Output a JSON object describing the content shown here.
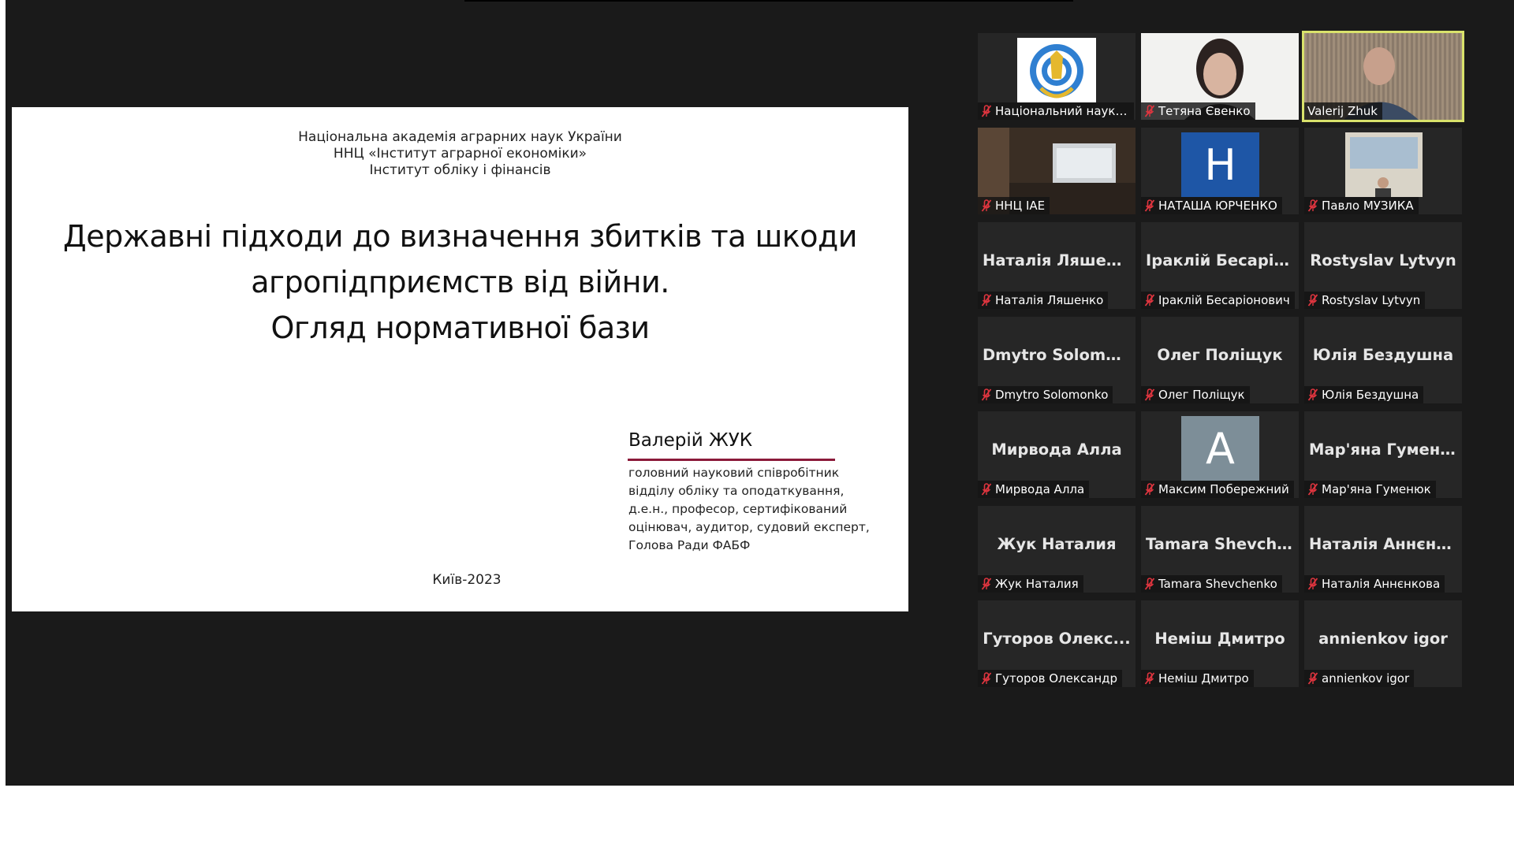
{
  "slide": {
    "institution_lines": [
      "Національна академія аграрних наук України",
      "ННЦ «Інститут аграрної економіки»",
      "Інститут обліку і фінансів"
    ],
    "title_lines": [
      "Державні підходи до визначення збитків та шкоди",
      "агропідприємств від війни.",
      "Огляд нормативної бази"
    ],
    "author": "Валерій ЖУК",
    "author_position_lines": [
      "головний науковий співробітник",
      "відділу обліку та оподаткування,",
      "д.е.н., професор, сертифікований",
      "оцінювач, аудитор, судовий експерт,",
      "Голова Ради ФАБФ"
    ],
    "city_year": "Київ-2023",
    "accent_color": "#8b1a3a"
  },
  "participants": [
    {
      "name": "Національний науков...",
      "display": "",
      "type": "logo",
      "muted": true
    },
    {
      "name": "Тетяна Євенко",
      "display": "",
      "type": "video-woman",
      "muted": true
    },
    {
      "name": "Valerij Zhuk",
      "display": "",
      "type": "video-man",
      "muted": false,
      "active_speaker": true
    },
    {
      "name": "ННЦ IAE",
      "display": "",
      "type": "video-room",
      "muted": true
    },
    {
      "name": "НАТАША ЮРЧЕНКО",
      "display": "H",
      "type": "avatar",
      "avatar_color": "#1e56a6",
      "muted": true
    },
    {
      "name": "Павло МУЗИКА",
      "display": "",
      "type": "video-office",
      "muted": true
    },
    {
      "name": "Наталія Ляшенко",
      "display": "Наталія Ляшенко",
      "type": "name",
      "muted": true
    },
    {
      "name": "Іраклій Бесаріонович",
      "display": "Іраклій Бесаріо...",
      "type": "name",
      "muted": true
    },
    {
      "name": "Rostyslav Lytvyn",
      "display": "Rostyslav Lytvyn",
      "type": "name",
      "muted": true
    },
    {
      "name": "Dmytro Solomonko",
      "display": "Dmytro Solomo...",
      "type": "name",
      "muted": true
    },
    {
      "name": "Олег Поліщук",
      "display": "Олег Поліщук",
      "type": "name",
      "muted": true
    },
    {
      "name": "Юлія Бездушна",
      "display": "Юлія Бездушна",
      "type": "name",
      "muted": true
    },
    {
      "name": "Мирвода Алла",
      "display": "Мирвода Алла",
      "type": "name",
      "muted": true
    },
    {
      "name": "Максим Побережний",
      "display": "A",
      "type": "avatar",
      "avatar_color": "#7d8e98",
      "muted": true
    },
    {
      "name": "Мар'яна Гуменюк",
      "display": "Мар'яна Гумен...",
      "type": "name",
      "muted": true
    },
    {
      "name": "Жук Наталия",
      "display": "Жук Наталия",
      "type": "name",
      "muted": true
    },
    {
      "name": "Tamara Shevchenko",
      "display": "Tamara Shevch...",
      "type": "name",
      "muted": true
    },
    {
      "name": "Наталія Аннєнкова",
      "display": "Наталія Аннєнк...",
      "type": "name",
      "muted": true
    },
    {
      "name": "Гуторов Олександр",
      "display": "Гуторов Олекс...",
      "type": "name",
      "muted": true
    },
    {
      "name": "Неміш Дмитро",
      "display": "Неміш Дмитро",
      "type": "name",
      "muted": true
    },
    {
      "name": "annienkov igor",
      "display": "annienkov igor",
      "type": "name",
      "muted": true
    }
  ],
  "colors": {
    "app_background": "#1a1a1a",
    "tile_background": "#262626",
    "active_speaker_border": "#d9e26b",
    "muted_icon": "#e0353f"
  }
}
